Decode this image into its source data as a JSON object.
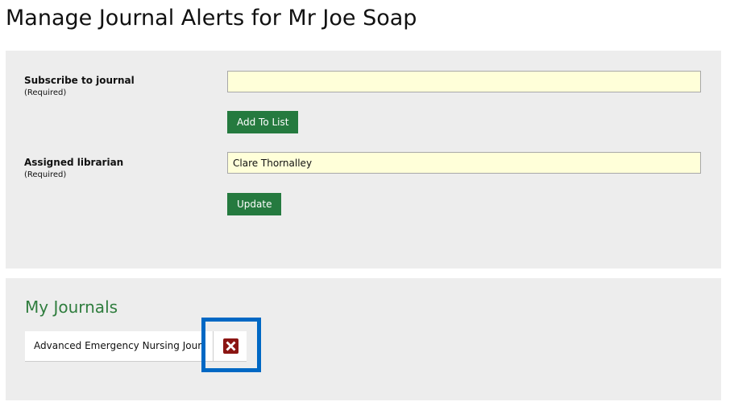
{
  "page": {
    "title": "Manage Journal Alerts for Mr Joe Soap"
  },
  "subscribe": {
    "label": "Subscribe to journal",
    "required_note": "(Required)",
    "value": "",
    "placeholder": "",
    "button_label": "Add To List"
  },
  "librarian": {
    "label": "Assigned librarian",
    "required_note": "(Required)",
    "value": "Clare Thornalley",
    "button_label": "Update"
  },
  "my_journals": {
    "heading": "My Journals",
    "items": [
      {
        "name": "Advanced Emergency Nursing Journal",
        "remove_icon": "close-x-icon"
      }
    ]
  },
  "colors": {
    "button_green": "#257a3f",
    "heading_green": "#2f7d3e",
    "input_fill": "#ffffd9",
    "panel_background": "#ededed",
    "remove_red": "#8b1513",
    "highlight_blue": "#0068c4"
  }
}
